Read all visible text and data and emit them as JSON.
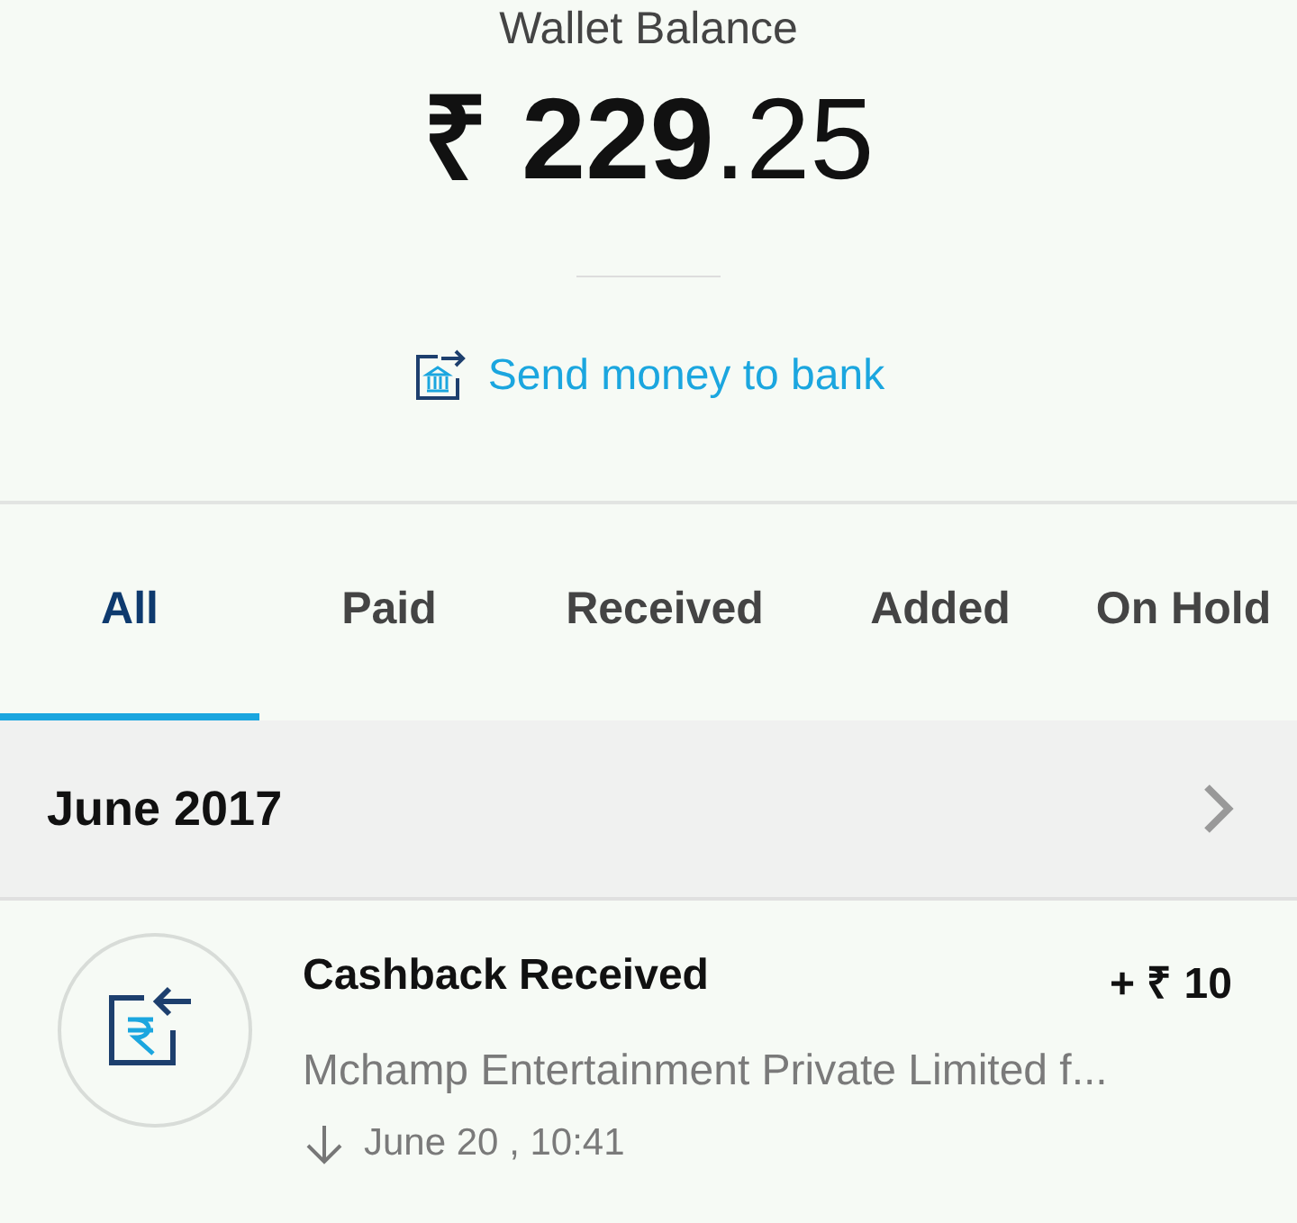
{
  "wallet": {
    "label": "Wallet Balance",
    "balance": "**₹ 229**.25",
    "send_link": "Send money to bank"
  },
  "tabs": [
    {
      "label": "All",
      "selected": true
    },
    {
      "label": "Paid",
      "selected": false
    },
    {
      "label": "Received",
      "selected": false
    },
    {
      "label": "Added",
      "selected": false
    },
    {
      "label": "On Hold",
      "selected": false
    }
  ],
  "month_header": {
    "label": "June 2017"
  },
  "transactions": [
    {
      "title": "Cashback Received",
      "amount": "+ ₹ 10",
      "description": "Mchamp Entertainment Private Limited f...",
      "time": "June 20 , 10:41"
    }
  ]
}
